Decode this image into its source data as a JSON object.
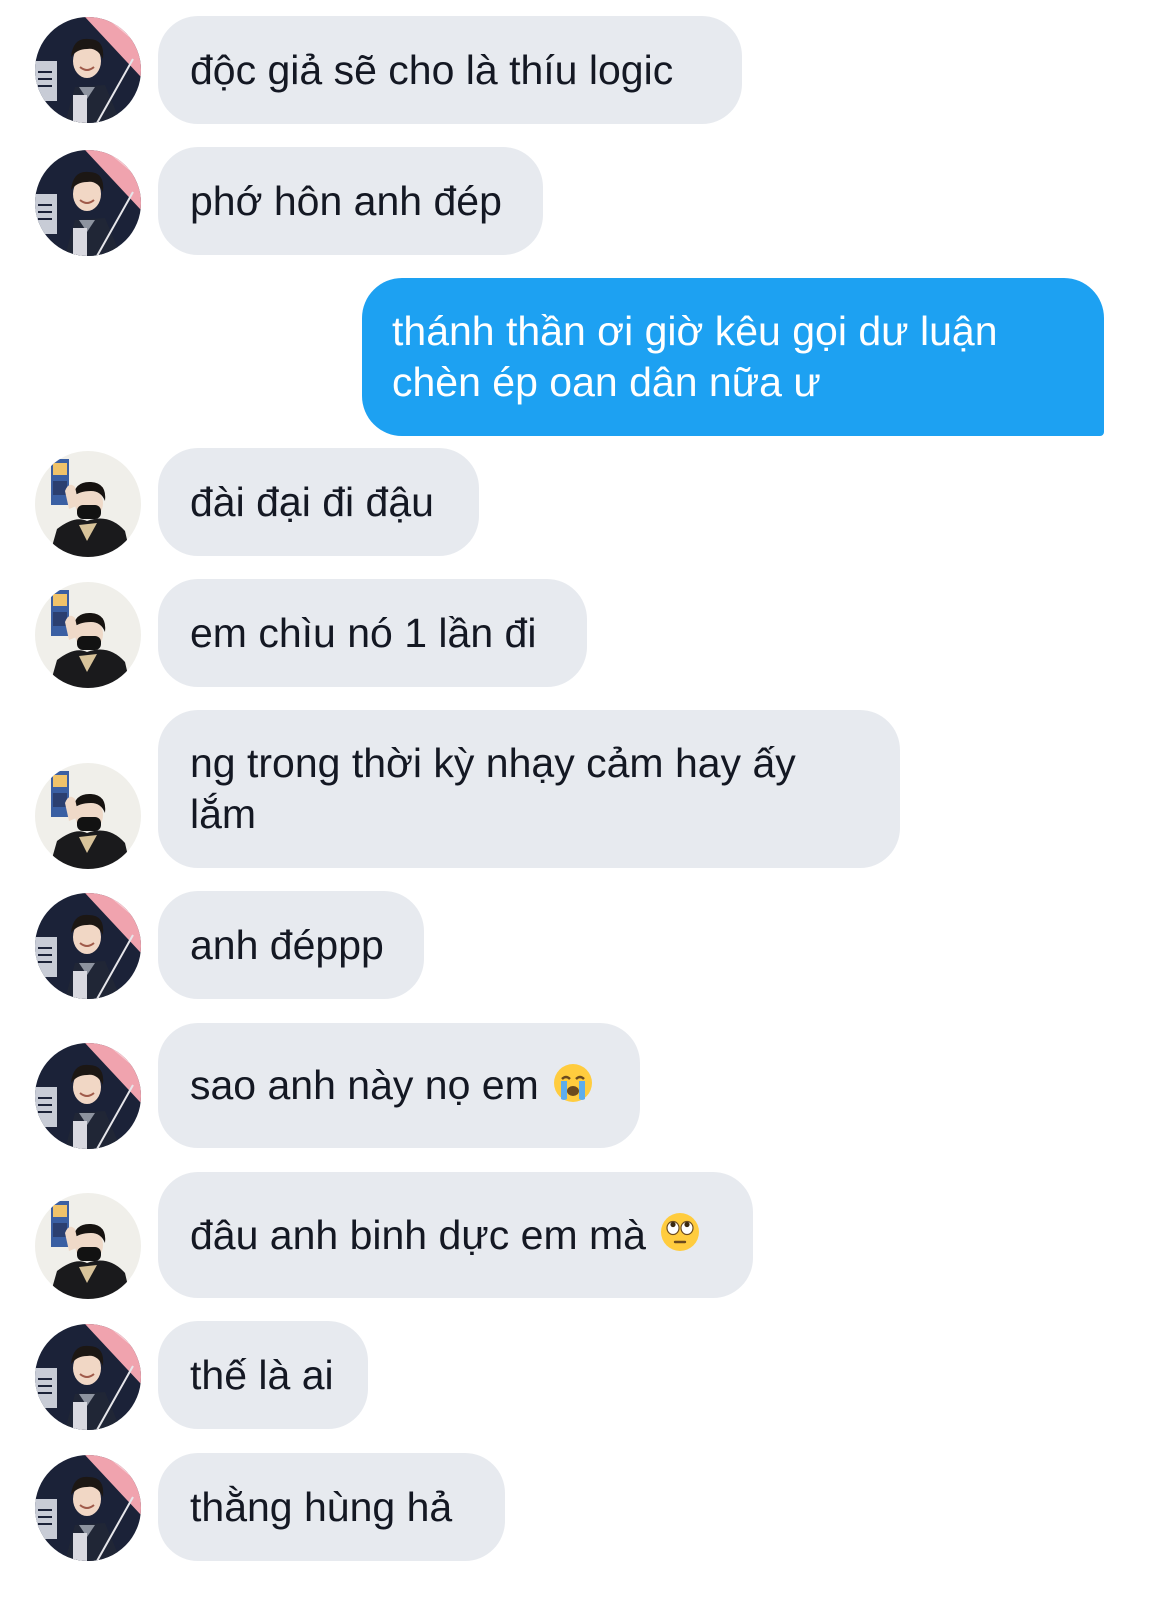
{
  "messages": [
    {
      "side": "in",
      "avatar": "avatar-a",
      "text": "độc giả sẽ cho là thíu logic"
    },
    {
      "side": "in",
      "avatar": "avatar-a",
      "text": "phớ hôn anh đép"
    },
    {
      "side": "out",
      "text": "thánh thần ơi giờ kêu gọi dư luận chèn ép oan dân nữa ư"
    },
    {
      "side": "in",
      "avatar": "avatar-b",
      "text": "đài đại đi đậu"
    },
    {
      "side": "in",
      "avatar": "avatar-b",
      "text": "em chìu nó 1 lần đi"
    },
    {
      "side": "in",
      "avatar": "avatar-b",
      "text": "ng trong thời kỳ nhạy cảm hay ấy lắm"
    },
    {
      "side": "in",
      "avatar": "avatar-a",
      "text": "anh đéppp"
    },
    {
      "side": "in",
      "avatar": "avatar-a",
      "text": "sao anh này nọ em",
      "emoji": "loudly-crying-face-emoji"
    },
    {
      "side": "in",
      "avatar": "avatar-b",
      "text": "đâu anh binh dực em mà",
      "emoji": "face-with-rolling-eyes-emoji"
    },
    {
      "side": "in",
      "avatar": "avatar-a",
      "text": "thế là ai"
    },
    {
      "side": "in",
      "avatar": "avatar-a",
      "text": "thằng hùng hả"
    }
  ],
  "colors": {
    "incoming_bubble": "#e7eaef",
    "outgoing_bubble": "#1da1f2",
    "incoming_text": "#141823",
    "outgoing_text": "#ffffff"
  }
}
